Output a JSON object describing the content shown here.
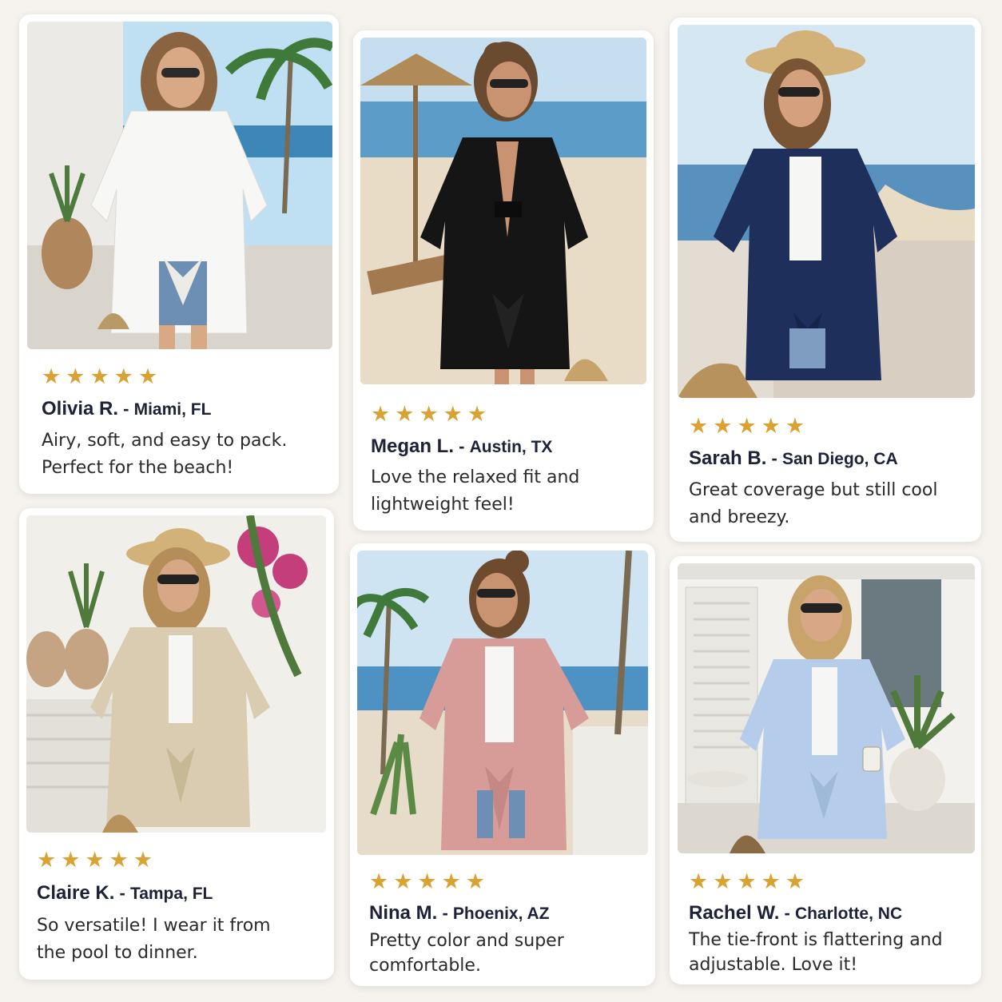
{
  "reviews": [
    {
      "rating": 5,
      "name": "Olivia R.",
      "separator": " - ",
      "location": "Miami, FL",
      "text": "Airy, soft, and easy to pack. Perfect for the beach!",
      "photo": {
        "subject": "white tie-front kimono cover-up",
        "garment_color": "#f7f7f5",
        "setting": "villa terrace with palm trees"
      }
    },
    {
      "rating": 5,
      "name": "Megan L.",
      "separator": " - ",
      "location": "Austin, TX",
      "text": "Love the relaxed fit and lightweight feel!",
      "photo": {
        "subject": "black tie-front kimono cover-up",
        "garment_color": "#151515",
        "setting": "beach with umbrella and loungers"
      }
    },
    {
      "rating": 5,
      "name": "Sarah B.",
      "separator": " - ",
      "location": "San Diego, CA",
      "text": "Great coverage but still cool and breezy.",
      "photo": {
        "subject": "navy tie-front kimono cover-up",
        "garment_color": "#1f2f5c",
        "setting": "seaside promenade"
      }
    },
    {
      "rating": 5,
      "name": "Claire K.",
      "separator": " - ",
      "location": "Tampa, FL",
      "text": "So versatile! I wear it from the pool to dinner.",
      "photo": {
        "subject": "beige tie-front kimono cover-up",
        "garment_color": "#d9ccb0",
        "setting": "white patio with bougainvillea"
      }
    },
    {
      "rating": 5,
      "name": "Nina M.",
      "separator": " - ",
      "location": "Phoenix, AZ",
      "text": "Pretty color and super comfortable.",
      "photo": {
        "subject": "pink tie-front kimono cover-up",
        "garment_color": "#d79c98",
        "setting": "beach walkway with palms"
      }
    },
    {
      "rating": 5,
      "name": "Rachel W.",
      "separator": " - ",
      "location": "Charlotte, NC",
      "text": "The tie-front is flattering and adjustable. Love it!",
      "photo": {
        "subject": "light blue tie-front kimono cover-up",
        "garment_color": "#b5cdea",
        "setting": "patio with shutters and plants"
      }
    }
  ],
  "star_glyph": "★",
  "star_color": "#d9a233"
}
